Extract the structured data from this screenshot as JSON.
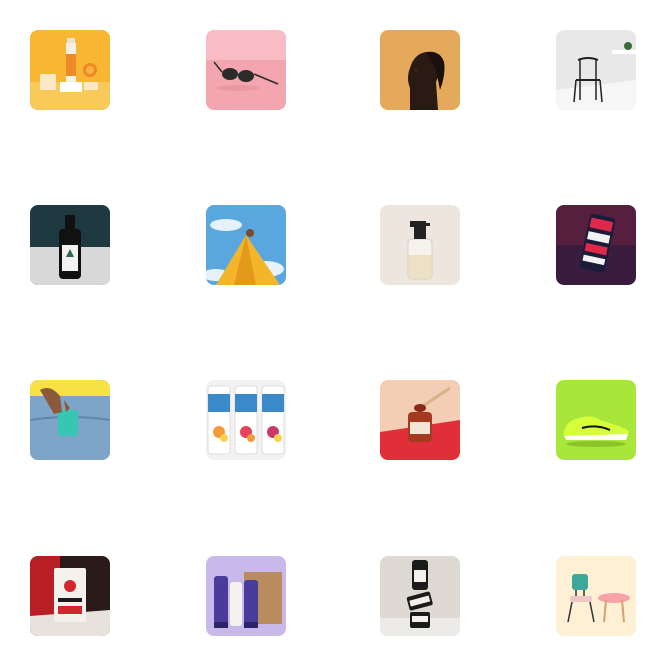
{
  "products": [
    {
      "name": "juice-bottles",
      "icon": "juice-bottle-icon",
      "bg": "#f7b733"
    },
    {
      "name": "sunglasses",
      "icon": "sunglasses-icon",
      "bg": "#f4a6b0"
    },
    {
      "name": "portrait",
      "icon": "portrait-icon",
      "bg": "#e5a95b"
    },
    {
      "name": "chair",
      "icon": "chair-icon",
      "bg": "#e8e8e8"
    },
    {
      "name": "black-bottle",
      "icon": "bottle-icon",
      "bg": "#1e3a40"
    },
    {
      "name": "yellow-dress-sky",
      "icon": "dress-icon",
      "bg": "#5aa7e0"
    },
    {
      "name": "spray-bottle",
      "icon": "spray-bottle-icon",
      "bg": "#ece6df"
    },
    {
      "name": "phone-case",
      "icon": "phone-case-icon",
      "bg": "#3a1d3e"
    },
    {
      "name": "pocket-pack",
      "icon": "pocket-pack-icon",
      "bg": "#8fb6d8"
    },
    {
      "name": "drink-cans",
      "icon": "can-icon",
      "bg": "#f2f2f2"
    },
    {
      "name": "jam-jar",
      "icon": "jar-icon",
      "bg": "#f3cdb4"
    },
    {
      "name": "sneaker",
      "icon": "sneaker-icon",
      "bg": "#a8e63a"
    },
    {
      "name": "coffee-bag",
      "icon": "coffee-bag-icon",
      "bg": "#2a1a1a"
    },
    {
      "name": "cosmetic-tubes",
      "icon": "tube-icon",
      "bg": "#c9b8ea"
    },
    {
      "name": "stacked-jars",
      "icon": "stacked-jars-icon",
      "bg": "#dedad3"
    },
    {
      "name": "furniture",
      "icon": "furniture-icon",
      "bg": "#fdf0d4"
    }
  ]
}
